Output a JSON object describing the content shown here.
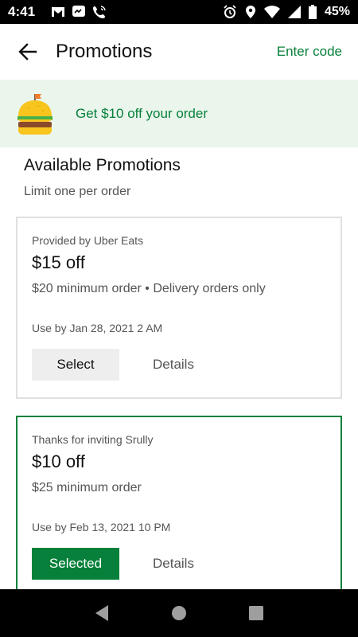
{
  "status_bar": {
    "time": "4:41",
    "battery": "45%",
    "left_icons": [
      "gmail-icon",
      "messenger-icon",
      "wifi-call-icon"
    ],
    "right_icons": [
      "alarm-icon",
      "location-icon",
      "wifi-icon",
      "signal-icon",
      "battery-icon"
    ]
  },
  "header": {
    "title": "Promotions",
    "enter_code": "Enter code"
  },
  "banner": {
    "text": "Get $10 off your order",
    "icon": "burger-icon"
  },
  "section": {
    "title": "Available Promotions",
    "subtitle": "Limit one per order"
  },
  "promotions": [
    {
      "provider": "Provided by Uber Eats",
      "amount": "$15 off",
      "terms": "$20 minimum order • Delivery orders only",
      "expiry": "Use by Jan 28, 2021 2 AM",
      "button": "Select",
      "details": "Details",
      "selected": false
    },
    {
      "provider": "Thanks for inviting Srully",
      "amount": "$10 off",
      "terms": "$25 minimum order",
      "expiry": "Use by Feb 13, 2021 10 PM",
      "button": "Selected",
      "details": "Details",
      "selected": true
    }
  ],
  "colors": {
    "accent": "#06803a",
    "banner_bg": "#eaf5ec"
  }
}
